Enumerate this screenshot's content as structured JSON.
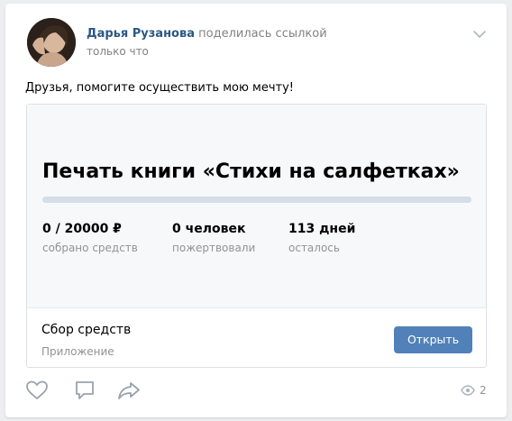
{
  "post": {
    "author": "Дарья Рузанова",
    "action": "поделилась ссылкой",
    "time": "только что",
    "text": "Друзья, помогите осуществить мою мечту!"
  },
  "fundraiser": {
    "title": "Печать книги «Стихи на салфетках»",
    "progress_fraction": 0,
    "stats": [
      {
        "value": "0 / 20000 ₽",
        "label": "собрано средств"
      },
      {
        "value": "0 человек",
        "label": "пожертвовали"
      },
      {
        "value": "113 дней",
        "label": "осталось"
      }
    ]
  },
  "app": {
    "name": "Сбор средств",
    "type": "Приложение",
    "open_label": "Открыть"
  },
  "footer": {
    "views": "2"
  },
  "icons": {
    "menu": "chevron-down-icon",
    "like": "heart-icon",
    "comment": "comment-icon",
    "share": "share-icon",
    "views": "eye-icon"
  },
  "colors": {
    "link": "#2a5885",
    "accent": "#5181b8",
    "muted": "#939393",
    "background": "#edeef0"
  }
}
